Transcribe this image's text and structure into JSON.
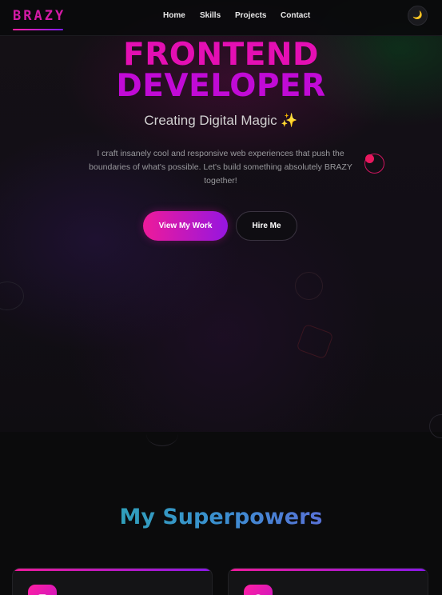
{
  "nav": {
    "logo": "BRAZY",
    "links": [
      {
        "label": "Home"
      },
      {
        "label": "Skills"
      },
      {
        "label": "Projects"
      },
      {
        "label": "Contact"
      }
    ],
    "theme_toggle_icon": "moon-icon",
    "theme_toggle_glyph": "🌙"
  },
  "hero": {
    "title_line1": "FRONTEND",
    "title_line2": "DEVELOPER",
    "subtitle": "Creating Digital Magic",
    "subtitle_emoji": "✨",
    "description": "I craft insanely cool and responsive web experiences that push the boundaries of what's possible. Let's build something absolutely BRAZY together!",
    "primary_button": "View My Work",
    "secondary_button": "Hire Me"
  },
  "skills": {
    "title": "My Superpowers",
    "cards": [
      {
        "icon": "skill-icon"
      },
      {
        "icon": "skill-icon"
      }
    ]
  },
  "colors": {
    "accent_pink": "#ee1a9a",
    "accent_purple": "#9616e0",
    "background": "#0b0b0c"
  }
}
